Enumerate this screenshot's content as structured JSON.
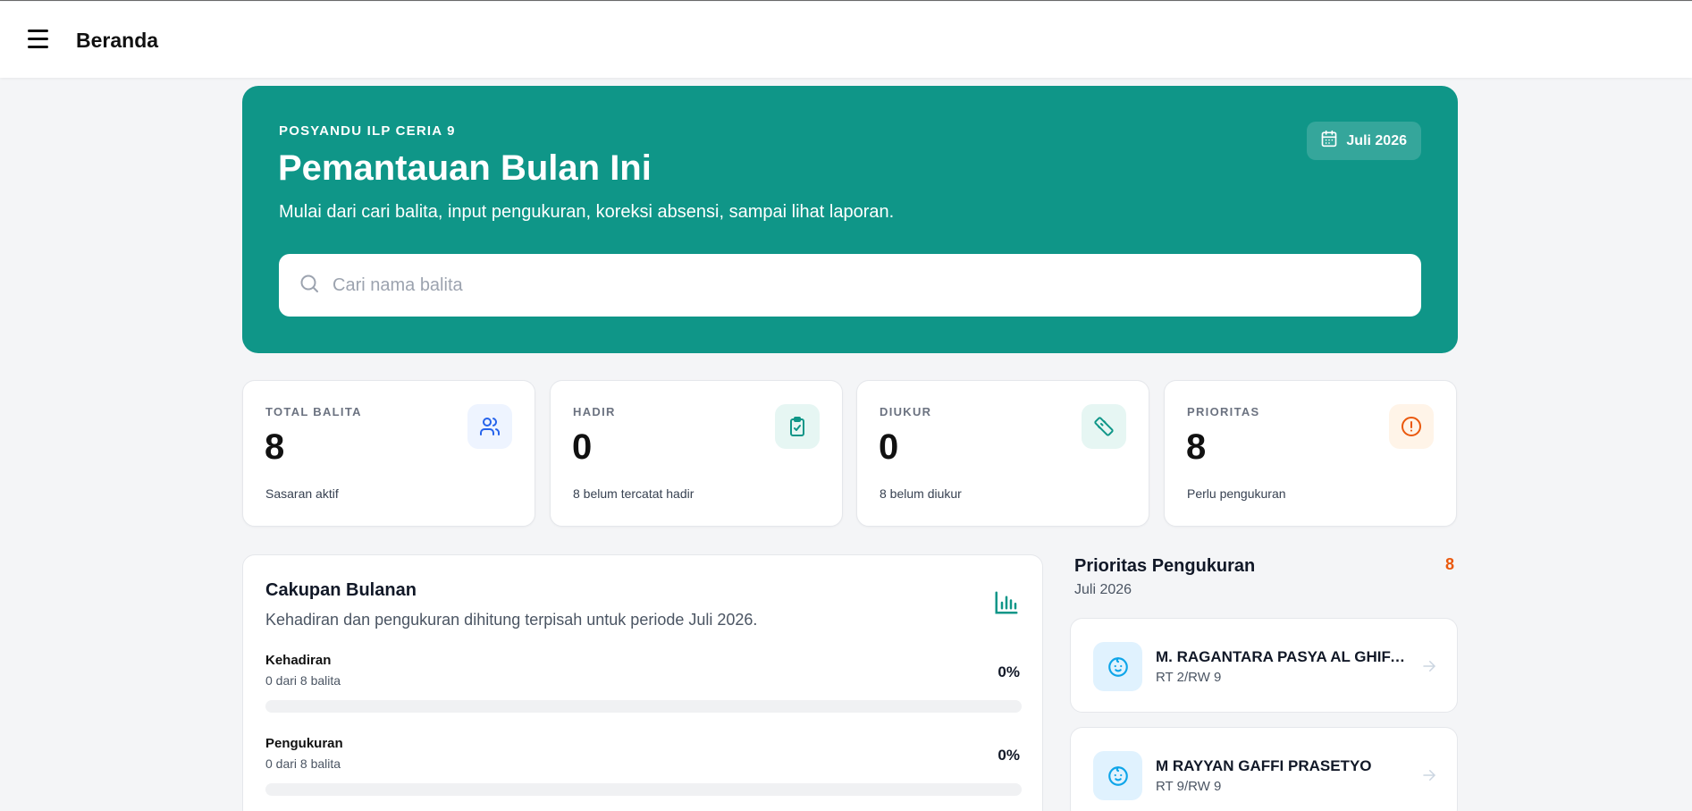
{
  "topbar": {
    "title": "Beranda"
  },
  "hero": {
    "eyebrow": "POSYANDU ILP CERIA 9",
    "title": "Pemantauan Bulan Ini",
    "subtitle": "Mulai dari cari balita, input pengukuran, koreksi absensi, sampai lihat laporan.",
    "month": "Juli 2026",
    "search_placeholder": "Cari nama balita"
  },
  "stats": [
    {
      "label": "TOTAL BALITA",
      "value": "8",
      "sub": "Sasaran aktif",
      "icon": "users-icon",
      "icon_bg": "#eef2ff",
      "icon_color": "#2563eb"
    },
    {
      "label": "HADIR",
      "value": "0",
      "sub": "8 belum tercatat hadir",
      "icon": "clipboard-check-icon",
      "icon_bg": "#e6f6f3",
      "icon_color": "#0f9688"
    },
    {
      "label": "DIUKUR",
      "value": "0",
      "sub": "8 belum diukur",
      "icon": "ruler-icon",
      "icon_bg": "#e6f6f3",
      "icon_color": "#0f9688"
    },
    {
      "label": "PRIORITAS",
      "value": "8",
      "sub": "Perlu pengukuran",
      "icon": "alert-circle-icon",
      "icon_bg": "#fff4e8",
      "icon_color": "#ea580c"
    }
  ],
  "coverage": {
    "title": "Cakupan Bulanan",
    "subtitle": "Kehadiran dan pengukuran dihitung terpisah untuk periode Juli 2026.",
    "rows": [
      {
        "label": "Kehadiran",
        "sub": "0 dari 8 balita",
        "percent_text": "0%",
        "percent": 0
      },
      {
        "label": "Pengukuran",
        "sub": "0 dari 8 balita",
        "percent_text": "0%",
        "percent": 0
      }
    ]
  },
  "priority": {
    "title": "Prioritas Pengukuran",
    "subtitle": "Juli 2026",
    "count": "8",
    "items": [
      {
        "name": "M. RAGANTARA PASYA AL GHIFARI",
        "address": "RT 2/RW 9"
      },
      {
        "name": "M RAYYAN GAFFI PRASETYO",
        "address": "RT 9/RW 9"
      }
    ]
  },
  "colors": {
    "accent": "#0f9688",
    "warning": "#ea580c",
    "info": "#2563eb"
  }
}
